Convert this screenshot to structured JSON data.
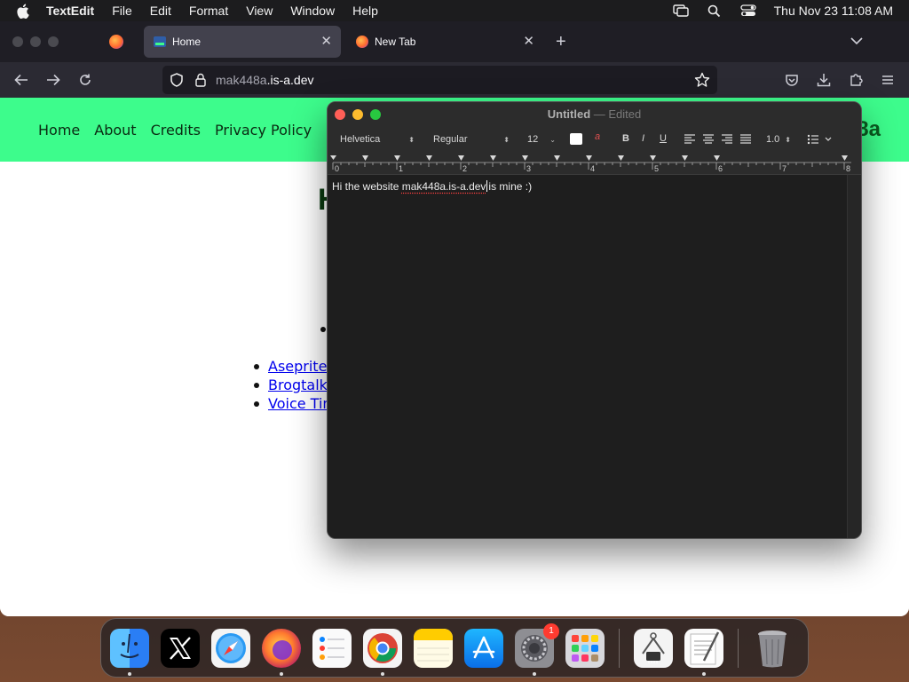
{
  "menubar": {
    "app_name": "TextEdit",
    "menus": [
      "File",
      "Edit",
      "Format",
      "View",
      "Window",
      "Help"
    ],
    "datetime": "Thu Nov 23  11:08 AM"
  },
  "browser": {
    "tabs": [
      {
        "label": "Home",
        "active": true
      },
      {
        "label": "New Tab",
        "active": false
      }
    ],
    "url": {
      "prefix": "mak448a",
      "rest": ".is-a.dev"
    }
  },
  "website": {
    "nav": [
      "Home",
      "About",
      "Credits",
      "Privacy Policy"
    ],
    "brand_partial": "8a",
    "heading_partial": "H",
    "links": [
      "Aseprite c",
      "Brogtalk I",
      "Voice Tim"
    ]
  },
  "textedit": {
    "title": "Untitled",
    "title_sep": " — ",
    "status": "Edited",
    "font_family": "Helvetica",
    "font_style": "Regular",
    "font_size": "12",
    "bold_label": "B",
    "italic_label": "I",
    "underline_label": "U",
    "highlight_label": "a",
    "line_spacing": "1.0",
    "ruler_marks": [
      "0",
      "1",
      "2",
      "3",
      "4",
      "5",
      "6",
      "7",
      "8"
    ],
    "text_before": "Hi the website ",
    "text_misspelled": "mak448a.is-a.dev",
    "text_after": "is mine :)"
  },
  "dock": {
    "apps": [
      "finder",
      "x",
      "safari",
      "firefox",
      "reminders",
      "chrome",
      "notes",
      "app-store",
      "system-settings",
      "launchpad",
      "archive-utility",
      "textedit",
      "trash"
    ],
    "system_settings_badge": "1"
  },
  "colors": {
    "site_header": "#3dfc8c",
    "link": "#0000ee",
    "close": "#ff5f57",
    "minimize": "#febc2e",
    "zoom": "#28c840"
  }
}
